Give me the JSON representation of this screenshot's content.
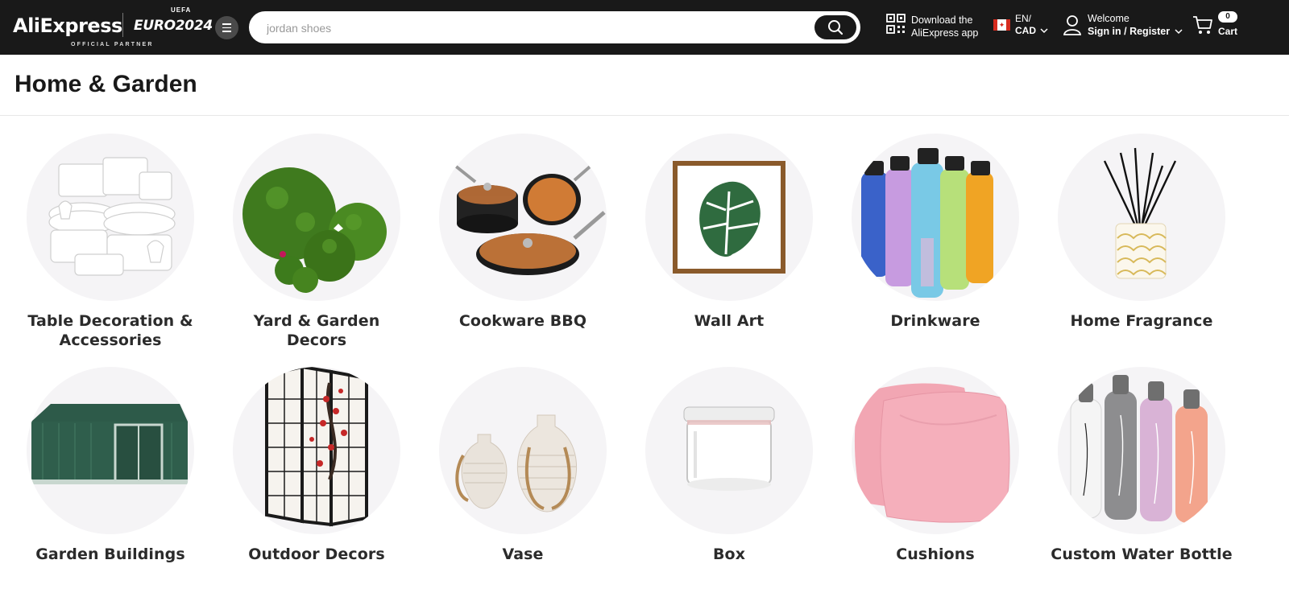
{
  "header": {
    "logo_text": "AliExpress",
    "euro_top": "UEFA",
    "euro_text": "EURO2024",
    "partner_text": "OFFICIAL PARTNER",
    "search_placeholder": "jordan shoes",
    "download_line1": "Download the",
    "download_line2": "AliExpress app",
    "lang_line1": "EN/",
    "lang_line2": "CAD",
    "welcome": "Welcome",
    "sign_in": "Sign in / Register",
    "cart_count": "0",
    "cart_label": "Cart"
  },
  "page": {
    "title": "Home & Garden"
  },
  "categories": [
    {
      "line1": "Table Decoration &",
      "line2": "Accessories",
      "icon": "tableware-image"
    },
    {
      "line1": "Yard & Garden",
      "line2": "Decors",
      "icon": "topiary-balls-image"
    },
    {
      "line1": "Cookware BBQ",
      "line2": "",
      "icon": "cookware-image"
    },
    {
      "line1": "Wall Art",
      "line2": "",
      "icon": "framed-leaf-image"
    },
    {
      "line1": "Drinkware",
      "line2": "",
      "icon": "water-bottles-image"
    },
    {
      "line1": "Home Fragrance",
      "line2": "",
      "icon": "reed-diffuser-image"
    },
    {
      "line1": "Garden Buildings",
      "line2": "",
      "icon": "garden-shed-image"
    },
    {
      "line1": "Outdoor Decors",
      "line2": "",
      "icon": "folding-screen-image"
    },
    {
      "line1": "Vase",
      "line2": "",
      "icon": "vases-image"
    },
    {
      "line1": "Box",
      "line2": "",
      "icon": "glass-jar-image"
    },
    {
      "line1": "Cushions",
      "line2": "",
      "icon": "pink-cushions-image"
    },
    {
      "line1": "Custom Water Bottle",
      "line2": "",
      "icon": "custom-bottles-image"
    }
  ],
  "colors": {
    "header_bg": "#191919",
    "circle_bg": "#f5f4f6",
    "text": "#191919"
  }
}
